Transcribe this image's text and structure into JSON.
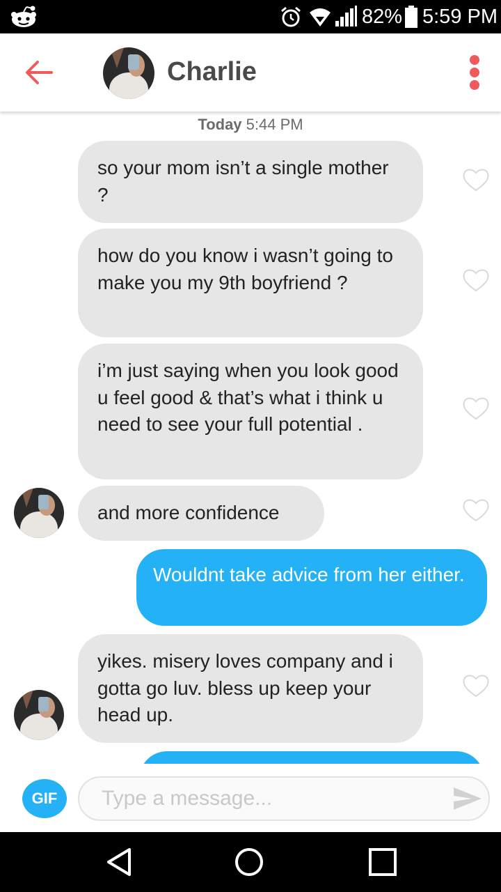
{
  "status_bar": {
    "battery_percent": "82%",
    "time": "5:59 PM",
    "icons": [
      "reddit-alien-icon",
      "alarm-icon",
      "wifi-icon",
      "signal-icon",
      "battery-icon"
    ]
  },
  "header": {
    "contact_name": "Charlie",
    "back_icon": "arrow-left-icon",
    "menu_icon": "more-vertical-icon",
    "accent_color": "#ef5a5a"
  },
  "conversation": {
    "date_label": {
      "day": "Today",
      "time": "5:44 PM"
    },
    "messages": [
      {
        "direction": "received",
        "text": "so your mom isn’t a single mother ?"
      },
      {
        "direction": "received",
        "text": "how do you know i wasn’t going to make you my 9th boyfriend ?"
      },
      {
        "direction": "received",
        "text": "i’m just saying when you look good u feel good & that’s what i think u need to see your full potential ."
      },
      {
        "direction": "received",
        "text": "and more confidence"
      },
      {
        "direction": "sent",
        "text": "Wouldnt take advice from her either."
      },
      {
        "direction": "received",
        "text": "yikes. misery loves company and i gotta go luv. bless up keep your head up."
      }
    ],
    "colors": {
      "received_bubble": "#e6e6e6",
      "sent_bubble": "#24b1f5"
    }
  },
  "composer": {
    "gif_label": "GIF",
    "placeholder": "Type a message...",
    "send_icon": "send-icon"
  },
  "nav_bar": {
    "icons": [
      "back-triangle-icon",
      "home-circle-icon",
      "recents-square-icon"
    ]
  }
}
